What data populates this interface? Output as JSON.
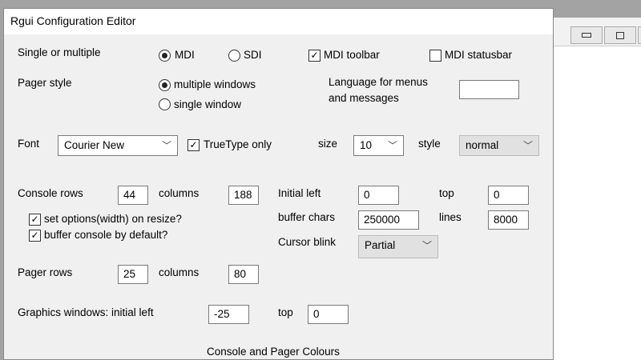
{
  "window": {
    "title": "Rgui Configuration Editor"
  },
  "labels": {
    "single_multiple": "Single or multiple",
    "pager_style": "Pager style",
    "language": "Language for menus",
    "language2": "and messages",
    "font": "Font",
    "size": "size",
    "style": "style",
    "console_rows": "Console  rows",
    "console_columns": "columns",
    "initial_left": "Initial left",
    "top": "top",
    "buffer_chars": "buffer chars",
    "lines": "lines",
    "cursor_blink": "Cursor blink",
    "pager_rows": "Pager  rows",
    "pager_columns": "columns",
    "graphics_left": "Graphics windows: initial left",
    "graphics_top": "top",
    "colours": "Console and Pager Colours"
  },
  "radios": {
    "mdi": {
      "label": "MDI",
      "checked": true
    },
    "sdi": {
      "label": "SDI",
      "checked": false
    },
    "multiple_windows": {
      "label": "multiple windows",
      "checked": true
    },
    "single_window": {
      "label": "single window",
      "checked": false
    }
  },
  "checkboxes": {
    "mdi_toolbar": {
      "label": "MDI toolbar",
      "checked": true
    },
    "mdi_statusbar": {
      "label": "MDI statusbar",
      "checked": false
    },
    "truetype": {
      "label": "TrueType only",
      "checked": true
    },
    "set_options": {
      "label": "set options(width) on resize?",
      "checked": true
    },
    "buffer_console": {
      "label": "buffer console by default?",
      "checked": true
    }
  },
  "fields": {
    "language": "",
    "console_rows": "44",
    "console_columns": "188",
    "initial_left": "0",
    "top": "0",
    "buffer_chars": "250000",
    "lines": "8000",
    "pager_rows": "25",
    "pager_columns": "80",
    "graphics_left": "-25",
    "graphics_top": "0"
  },
  "selects": {
    "font": "Courier New",
    "size": "10",
    "style": "normal",
    "cursor_blink": "Partial"
  }
}
